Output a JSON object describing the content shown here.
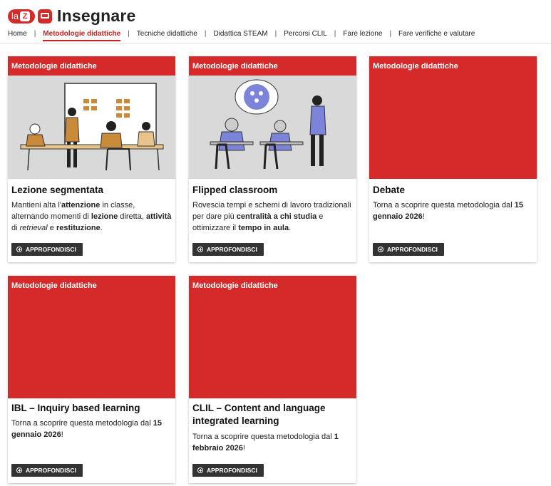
{
  "brand": {
    "badge": "la",
    "badge_letter": "Z",
    "name": "Insegnare"
  },
  "nav": {
    "items": [
      {
        "label": "Home",
        "active": false
      },
      {
        "label": "Metodologie didattiche",
        "active": true
      },
      {
        "label": "Tecniche didattiche",
        "active": false
      },
      {
        "label": "Didattica STEAM",
        "active": false
      },
      {
        "label": "Percorsi CLIL",
        "active": false
      },
      {
        "label": "Fare lezione",
        "active": false
      },
      {
        "label": "Fare verifiche e valutare",
        "active": false
      }
    ]
  },
  "cards": [
    {
      "tag": "Metodologie didattiche",
      "title": "Lezione segmentata",
      "desc_parts": [
        "Mantieni alta l'",
        "attenzione",
        " in classe, alternando momenti di ",
        "lezione",
        " diretta, ",
        "attività",
        " di ",
        "retrieval",
        " e ",
        "restituzione",
        "."
      ],
      "button": "APPROFONDISCI"
    },
    {
      "tag": "Metodologie didattiche",
      "title": "Flipped classroom",
      "desc_parts": [
        "Rovescia tempi e schemi di lavoro tradizionali per dare più ",
        "centralità a chi studia",
        " e ottimizzare il ",
        "tempo in aula",
        "."
      ],
      "button": "APPROFONDISCI"
    },
    {
      "tag": "Metodologie didattiche",
      "title": "Debate",
      "desc_parts": [
        "Torna a scoprire questa metodologia dal ",
        "15 gennaio 2026",
        "!"
      ],
      "button": "APPROFONDISCI"
    },
    {
      "tag": "Metodologie didattiche",
      "title": "IBL – Inquiry based learning",
      "desc_parts": [
        "Torna a scoprire questa metodologia dal ",
        "15 gennaio 2026",
        "!"
      ],
      "button": "APPROFONDISCI"
    },
    {
      "tag": "Metodologie didattiche",
      "title": "CLIL – Content and language integrated learning",
      "desc_parts": [
        "Torna a scoprire questa metodologia dal ",
        "1 febbraio 2026",
        "!"
      ],
      "button": "APPROFONDISCI"
    }
  ]
}
